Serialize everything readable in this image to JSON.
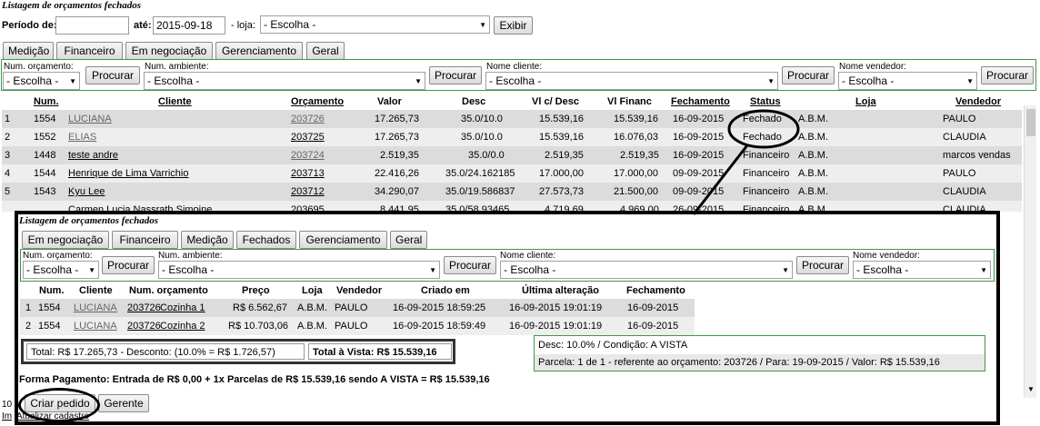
{
  "page_title": "Listagem de orçamentos fechados",
  "filter": {
    "period_label": "Período de:",
    "period_from": "",
    "until_label": "até:",
    "period_to": "2015-09-18",
    "store_label": "- loja:",
    "store_value": "- Escolha -",
    "show_button": "Exibir"
  },
  "tabs": [
    "Medição",
    "Financeiro",
    "Em negociação",
    "Gerenciamento",
    "Geral"
  ],
  "search": {
    "num_label": "Num. orçamento:",
    "num_value": "- Escolha -",
    "btn": "Procurar",
    "amb_label": "Num. ambiente:",
    "amb_value": "- Escolha -",
    "client_label": "Nome cliente:",
    "client_value": "- Escolha -",
    "seller_label": "Nome vendedor:",
    "seller_value": "- Escolha -"
  },
  "table": {
    "headers": {
      "num": "Num.",
      "cliente": "Cliente",
      "orcamento": "Orçamento",
      "valor": "Valor",
      "desc": "Desc",
      "vlc": "Vl c/ Desc",
      "vlf": "Vl Financ",
      "fech": "Fechamento",
      "status": "Status",
      "loja": "Loja",
      "vend": "Vendedor"
    },
    "rows": [
      {
        "idx": "1",
        "num": "1554",
        "cliente": "LUCIANA",
        "orc": "203726",
        "valor": "17.265,73",
        "desc": "35.0/10.0",
        "vlc": "15.539,16",
        "vlf": "15.539,16",
        "fech": "16-09-2015",
        "status": "Fechado",
        "loja": "A.B.M.",
        "vend": "PAULO"
      },
      {
        "idx": "2",
        "num": "1552",
        "cliente": "ELIAS",
        "orc": "203725",
        "valor": "17.265,73",
        "desc": "35.0/10.0",
        "vlc": "15.539,16",
        "vlf": "16.076,03",
        "fech": "16-09-2015",
        "status": "Fechado",
        "loja": "A.B.M.",
        "vend": "CLAUDIA"
      },
      {
        "idx": "3",
        "num": "1448",
        "cliente": "teste andre",
        "orc": "203724",
        "valor": "2.519,35",
        "desc": "35.0/0.0",
        "vlc": "2.519,35",
        "vlf": "2.519,35",
        "fech": "16-09-2015",
        "status": "Financeiro",
        "loja": "A.B.M.",
        "vend": "marcos vendas"
      },
      {
        "idx": "4",
        "num": "1544",
        "cliente": "Henrique de Lima Varrichio",
        "orc": "203713",
        "valor": "22.416,26",
        "desc": "35.0/24.162185",
        "vlc": "17.000,00",
        "vlf": "17.000,00",
        "fech": "09-09-2015",
        "status": "Financeiro",
        "loja": "A.B.M.",
        "vend": "PAULO"
      },
      {
        "idx": "5",
        "num": "1543",
        "cliente": "Kyu Lee",
        "orc": "203712",
        "valor": "34.290,07",
        "desc": "35.0/19.586837",
        "vlc": "27.573,73",
        "vlf": "21.500,00",
        "fech": "09-09-2015",
        "status": "Financeiro",
        "loja": "A.B.M.",
        "vend": "CLAUDIA"
      }
    ],
    "partial_row": {
      "cliente": "Carmen Lucia Nassrath Simoine",
      "orc": "203695",
      "valor": "8.441,95",
      "desc": "35.0/58.93465",
      "vlc": "4.719,69",
      "vlf": "4.969,00",
      "fech": "26-09-2015",
      "status": "Financeiro",
      "loja": "A.B.M.",
      "vend": "CLAUDIA"
    }
  },
  "bottom": {
    "count_fragment": "10",
    "link_fragment_1": "Im",
    "link_fragment_2": "Atualizar cadastro"
  },
  "overlay": {
    "title": "Listagem de orçamentos fechados",
    "tabs": [
      "Em negociação",
      "Financeiro",
      "Medição",
      "Fechados",
      "Gerenciamento",
      "Geral"
    ],
    "search": {
      "num_label": "Num. orçamento:",
      "num_value": "- Escolha -",
      "btn": "Procurar",
      "amb_label": "Num. ambiente:",
      "amb_value": "- Escolha -",
      "client_label": "Nome cliente:",
      "client_value": "- Escolha -",
      "seller_label": "Nome vendedor:",
      "seller_value": "- Escolha -"
    },
    "headers": {
      "num": "Num.",
      "cliente": "Cliente",
      "orc": "Num. orçamento",
      "preco": "Preço",
      "loja": "Loja",
      "vend": "Vendedor",
      "criado": "Criado em",
      "alt": "Última alteração",
      "fech": "Fechamento"
    },
    "rows": [
      {
        "idx": "1",
        "num": "1554",
        "cliente": "LUCIANA",
        "orc": "203726",
        "amb": "Cozinha 1",
        "preco": "R$ 6.562,67",
        "loja": "A.B.M.",
        "vend": "PAULO",
        "criado": "16-09-2015 18:59:25",
        "alt": "16-09-2015 19:01:19",
        "fech": "16-09-2015"
      },
      {
        "idx": "2",
        "num": "1554",
        "cliente": "LUCIANA",
        "orc": "203726",
        "amb": "Cozinha 2",
        "preco": "R$ 10.703,06",
        "loja": "A.B.M.",
        "vend": "PAULO",
        "criado": "16-09-2015 18:59:49",
        "alt": "16-09-2015 19:01:19",
        "fech": "16-09-2015"
      }
    ],
    "total_text": "Total: R$ 17.265,73 - Desconto: (10.0% = R$ 1.726,57)",
    "total_vista": "Total à Vista: R$ 15.539,16",
    "desc_cond": "Desc: 10.0% / Condição: A VISTA",
    "parcela": "Parcela: 1 de 1 - referente ao orçamento: 203726  / Para: 19-09-2015  / Valor: R$ 15.539,16",
    "forma_pagamento": "Forma Pagamento: Entrada de R$ 0,00 + 1x Parcelas de R$ 15.539,16 sendo A VISTA = R$ 15.539,16",
    "criar_pedido": "Criar pedido",
    "gerente": "Gerente"
  }
}
